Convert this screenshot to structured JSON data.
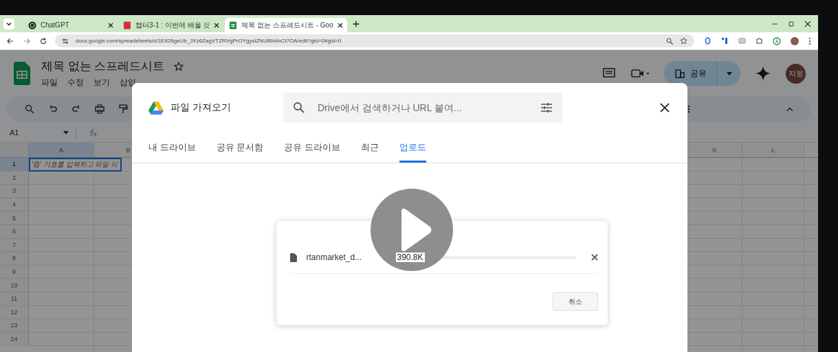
{
  "browser": {
    "tabs": [
      {
        "title": "ChatGPT",
        "kind": "chat",
        "selected": false
      },
      {
        "title": "챕터3-1 : 이번에 배울 것",
        "kind": "book",
        "selected": false
      },
      {
        "title": "제목 없는 스프레드시트 - Goo",
        "kind": "sheet",
        "selected": true
      }
    ],
    "url": "docs.google.com/spreadsheets/d/1EtI26geUb_JXz6ZagVTZRVgPrOYgysiZNUBN4nCt7OA/edit?gid=0#gid=0"
  },
  "sheet": {
    "title": "제목 없는 스프레드시트",
    "menu": [
      "파일",
      "수정",
      "보기",
      "삽입"
    ],
    "name_box": "A1",
    "share_label": "공유",
    "avatar": "지웅",
    "columns": [
      "A",
      "B",
      "K",
      "L"
    ],
    "rows": [
      "1",
      "2",
      "3",
      "4",
      "5",
      "6",
      "7",
      "8",
      "9",
      "10",
      "11",
      "12",
      "13",
      "14"
    ],
    "cell_a1": "'@' 기호를 입력하고 파일 이"
  },
  "dialog": {
    "title": "파일 가져오기",
    "search": {
      "placeholder": "Drive에서 검색하거나 URL 붙여..."
    },
    "tabs": [
      {
        "label": "내 드라이브",
        "selected": false
      },
      {
        "label": "공유 문서함",
        "selected": false
      },
      {
        "label": "공유 드라이브",
        "selected": false
      },
      {
        "label": "최근",
        "selected": false
      },
      {
        "label": "업로드",
        "selected": true
      }
    ],
    "upload": {
      "file_name": "rtanmarket_d...",
      "size": "390.8K",
      "cancel_label": "취소"
    }
  }
}
